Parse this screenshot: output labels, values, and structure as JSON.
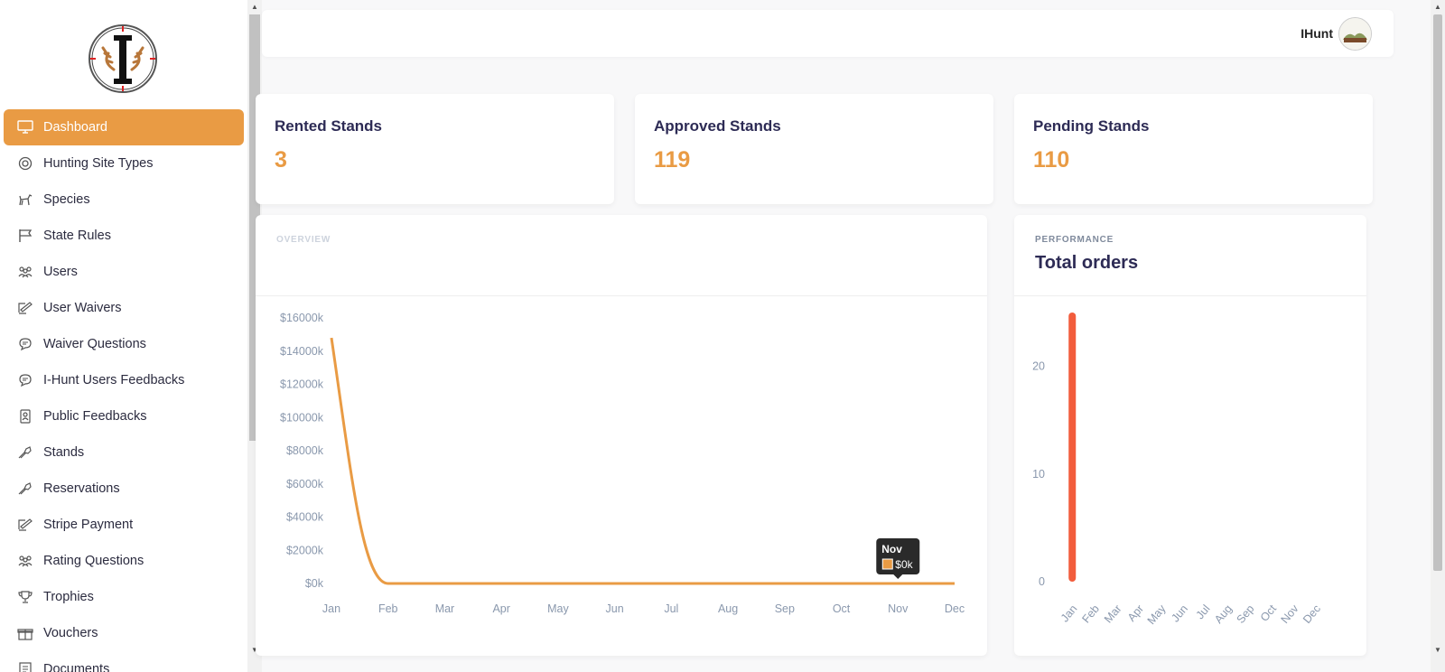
{
  "sidebar": {
    "items": [
      {
        "label": "Dashboard",
        "icon": "monitor-icon",
        "active": true
      },
      {
        "label": "Hunting Site Types",
        "icon": "target-icon"
      },
      {
        "label": "Species",
        "icon": "deer-icon"
      },
      {
        "label": "State Rules",
        "icon": "flag-icon"
      },
      {
        "label": "Users",
        "icon": "users-icon"
      },
      {
        "label": "User Waivers",
        "icon": "signature-icon"
      },
      {
        "label": "Waiver Questions",
        "icon": "chat-bubble-icon"
      },
      {
        "label": "I-Hunt Users Feedbacks",
        "icon": "chat-bubble-icon"
      },
      {
        "label": "Public Feedbacks",
        "icon": "contact-card-icon"
      },
      {
        "label": "Stands",
        "icon": "stand-icon"
      },
      {
        "label": "Reservations",
        "icon": "stand-icon"
      },
      {
        "label": "Stripe Payment",
        "icon": "signature-icon"
      },
      {
        "label": "Rating Questions",
        "icon": "users-icon"
      },
      {
        "label": "Trophies",
        "icon": "trophy-icon"
      },
      {
        "label": "Vouchers",
        "icon": "gift-icon"
      },
      {
        "label": "Documents",
        "icon": "document-icon"
      }
    ]
  },
  "header": {
    "username": "IHunt"
  },
  "stats": [
    {
      "title": "Rented Stands",
      "value": "3"
    },
    {
      "title": "Approved Stands",
      "value": "119"
    },
    {
      "title": "Pending Stands",
      "value": "110"
    }
  ],
  "overview": {
    "subtitle": "OVERVIEW",
    "title": ""
  },
  "performance": {
    "subtitle": "PERFORMANCE",
    "title": "Total orders"
  },
  "tooltip": {
    "month": "Nov",
    "value": "$0k"
  },
  "colors": {
    "accent": "#e99b44",
    "bar": "#f25c3c",
    "heading": "#2d2b55"
  },
  "chart_data": [
    {
      "type": "line",
      "x": [
        "Jan",
        "Feb",
        "Mar",
        "Apr",
        "May",
        "Jun",
        "Jul",
        "Aug",
        "Sep",
        "Oct",
        "Nov",
        "Dec"
      ],
      "series": [
        {
          "values": [
            14800,
            0,
            0,
            0,
            0,
            0,
            0,
            0,
            0,
            0,
            0,
            0
          ]
        }
      ],
      "ylim": [
        0,
        16000
      ],
      "yticks": [
        0,
        2000,
        4000,
        6000,
        8000,
        10000,
        12000,
        14000,
        16000
      ],
      "ytick_labels": [
        "$0k",
        "$2000k",
        "$4000k",
        "$6000k",
        "$8000k",
        "$10000k",
        "$12000k",
        "$14000k",
        "$16000k"
      ],
      "grid": false
    },
    {
      "type": "bar",
      "categories": [
        "Jan",
        "Feb",
        "Mar",
        "Apr",
        "May",
        "Jun",
        "Jul",
        "Aug",
        "Sep",
        "Oct",
        "Nov",
        "Dec"
      ],
      "values": [
        25,
        0,
        0,
        0,
        0,
        0,
        0,
        0,
        0,
        0,
        0,
        0
      ],
      "title": "Total orders",
      "ylim": [
        0,
        25
      ],
      "yticks": [
        0,
        10,
        20
      ],
      "grid": false
    }
  ]
}
